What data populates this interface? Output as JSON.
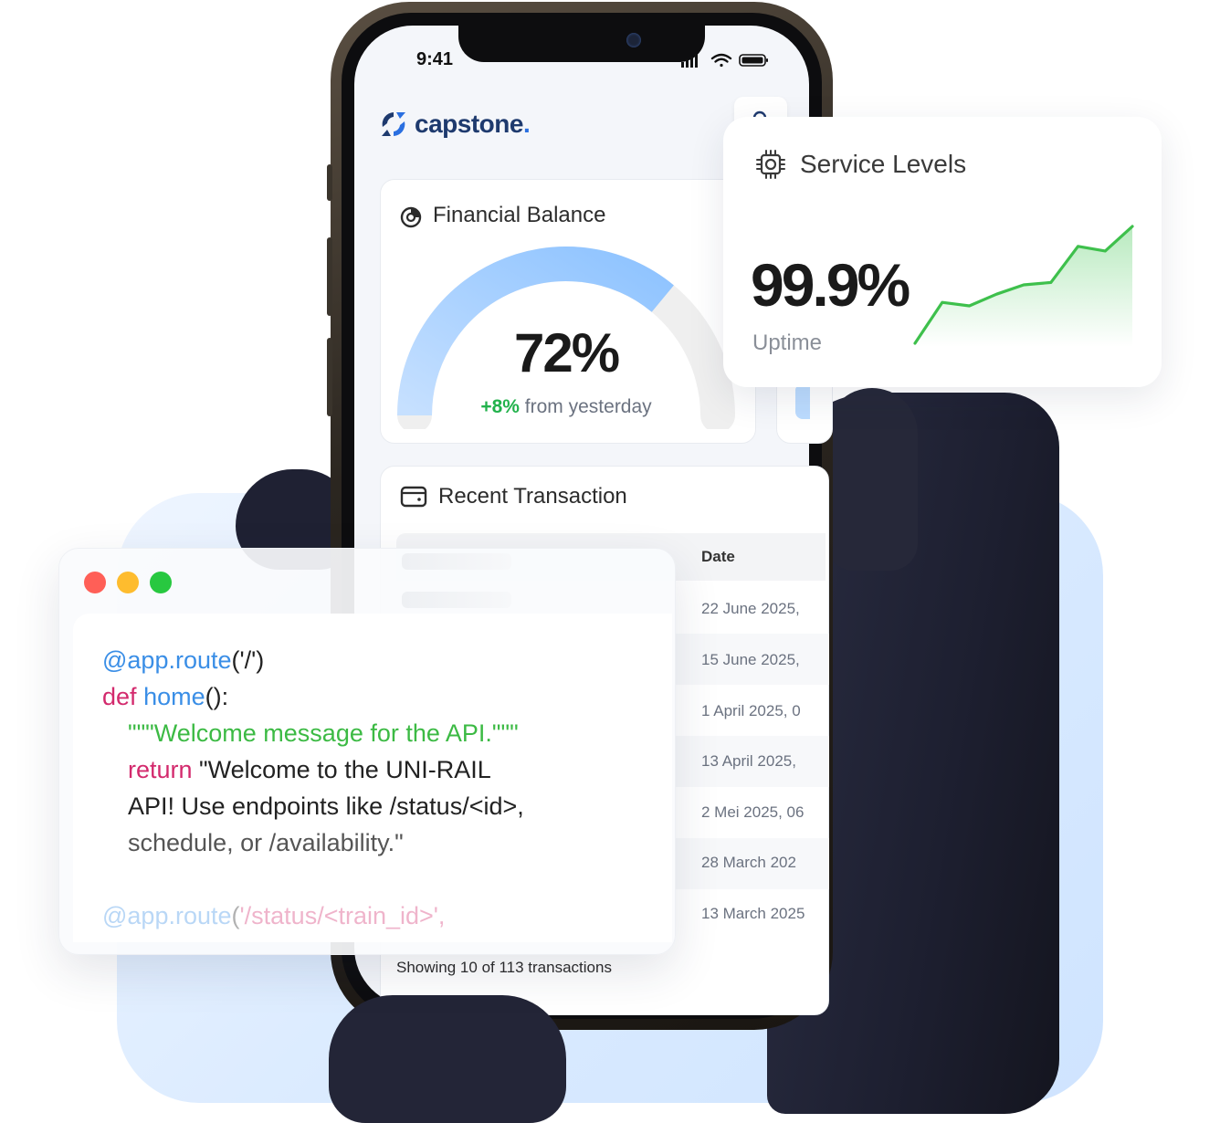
{
  "status_bar": {
    "time": "9:41"
  },
  "brand": {
    "name": "capstone",
    "dot": "."
  },
  "financial": {
    "title": "Financial Balance",
    "value": "72%",
    "progress_fraction": 0.72,
    "change": "+8%",
    "change_suffix": " from yesterday"
  },
  "transactions": {
    "title": "Recent Transaction",
    "date_header": "Date",
    "rows": [
      "22 June 2025,",
      "15 June 2025,",
      "1 April 2025, 0",
      "13 April 2025,",
      "2 Mei 2025, 06",
      "28 March 202",
      "13 March 2025"
    ],
    "footer": "Showing 10 of 113 transactions"
  },
  "service": {
    "title": "Service Levels",
    "value": "99.9%",
    "label": "Uptime",
    "trend": [
      0.0,
      0.35,
      0.32,
      0.42,
      0.5,
      0.52,
      0.83,
      0.79,
      1.0
    ]
  },
  "code": {
    "line1_decorator": "@app.route",
    "line1_args": "('/')",
    "line2_kw": "def",
    "line2_fn": "home",
    "line2_rest": "():",
    "line3_doc": "\"\"\"Welcome message for the API.\"\"\"",
    "line4_kw": "return",
    "line4_str": " \"Welcome to the UNI-RAIL",
    "line5": "API! Use endpoints like /status/<id>,",
    "line6": "schedule, or /availability.\"",
    "line7_decorator": "@app.route",
    "line7_paren": "(",
    "line7_str": "'/status/<train_id>',"
  },
  "colors": {
    "accent_blue": "#3a8ee6",
    "positive_green": "#22b24c",
    "keyword_pink": "#d32a6d",
    "string_green": "#3cba44",
    "window_red": "#ff5f57",
    "window_yellow": "#febc2e",
    "window_green": "#28c840"
  },
  "icons": [
    "gauge-icon",
    "wallet-icon",
    "cpu-chip-icon",
    "search-icon",
    "signal-icon",
    "wifi-icon",
    "battery-icon"
  ]
}
